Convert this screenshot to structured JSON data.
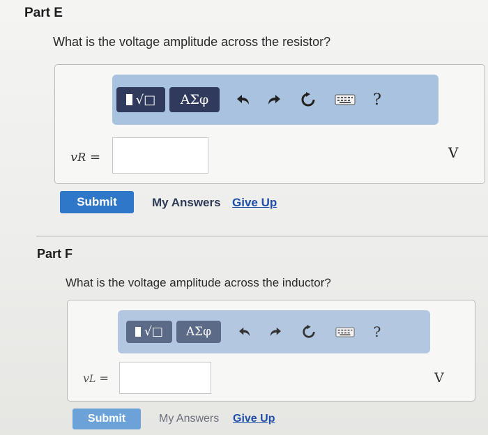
{
  "toolbar": {
    "template_label": "√□",
    "greek_label": "ΑΣφ",
    "help_label": "?"
  },
  "part_e": {
    "title": "Part E",
    "question": "What is the voltage amplitude across the resistor?",
    "var_symbol": "v",
    "var_sub": "R",
    "equals": "=",
    "input_value": "",
    "unit": "V",
    "submit_label": "Submit",
    "my_answers_label": "My Answers",
    "give_up_label": "Give Up"
  },
  "part_f": {
    "title": "Part F",
    "question": "What is the voltage amplitude across the inductor?",
    "var_symbol": "v",
    "var_sub": "L",
    "equals": "=",
    "input_value": "",
    "unit": "V",
    "submit_label": "Submit",
    "my_answers_label": "My Answers",
    "give_up_label": "Give Up"
  },
  "colors": {
    "toolbar_bg": "#a9c2df",
    "button_dark": "#2f3a5c",
    "submit_blue": "#2f77c9",
    "link_blue": "#1f4fa8"
  }
}
